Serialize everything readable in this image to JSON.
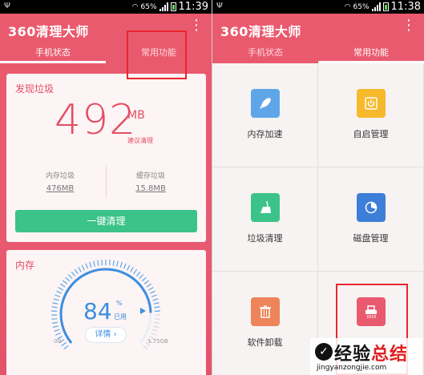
{
  "status": {
    "battery": "65%",
    "time": "11:39",
    "time_right": "11:38"
  },
  "app": {
    "title": "360清理大师",
    "menu_icon": "⋮"
  },
  "tabs": {
    "phone_status": "手机状态",
    "common_functions": "常用功能"
  },
  "junk": {
    "title": "发现垃圾",
    "amount": "492",
    "unit": "MB",
    "hint": "建议清理",
    "memory_junk_label": "内存垃圾",
    "memory_junk_value": "476MB",
    "cache_junk_label": "缓存垃圾",
    "cache_junk_value": "15.8MB",
    "clean_button": "一键清理"
  },
  "memory": {
    "title": "内存",
    "percent": "84",
    "percent_sign": "%",
    "used_label": "已用",
    "detail_button": "详情 ›",
    "min_label": "0G",
    "max_label": "1.75GB",
    "used_fraction": 0.84
  },
  "functions": [
    {
      "label": "内存加速",
      "color": "#5fa6e8",
      "icon": "rocket-icon"
    },
    {
      "label": "自启管理",
      "color": "#f7b92c",
      "icon": "power-icon"
    },
    {
      "label": "垃圾清理",
      "color": "#3cc389",
      "icon": "broom-icon"
    },
    {
      "label": "磁盘管理",
      "color": "#3d7fd8",
      "icon": "pie-chart-icon"
    },
    {
      "label": "软件卸载",
      "color": "#ee8459",
      "icon": "trash-icon"
    },
    {
      "label": "",
      "color": "#ea5a6e",
      "icon": "shredder-icon"
    }
  ],
  "watermark": {
    "main_a": "经验",
    "main_b": "总结",
    "sub": "jingyanzongjie.com"
  },
  "colors": {
    "brand": "#ea5a6e",
    "accent_green": "#3cc389",
    "gauge_blue": "#3d8ee0",
    "highlight": "#e8262d"
  }
}
